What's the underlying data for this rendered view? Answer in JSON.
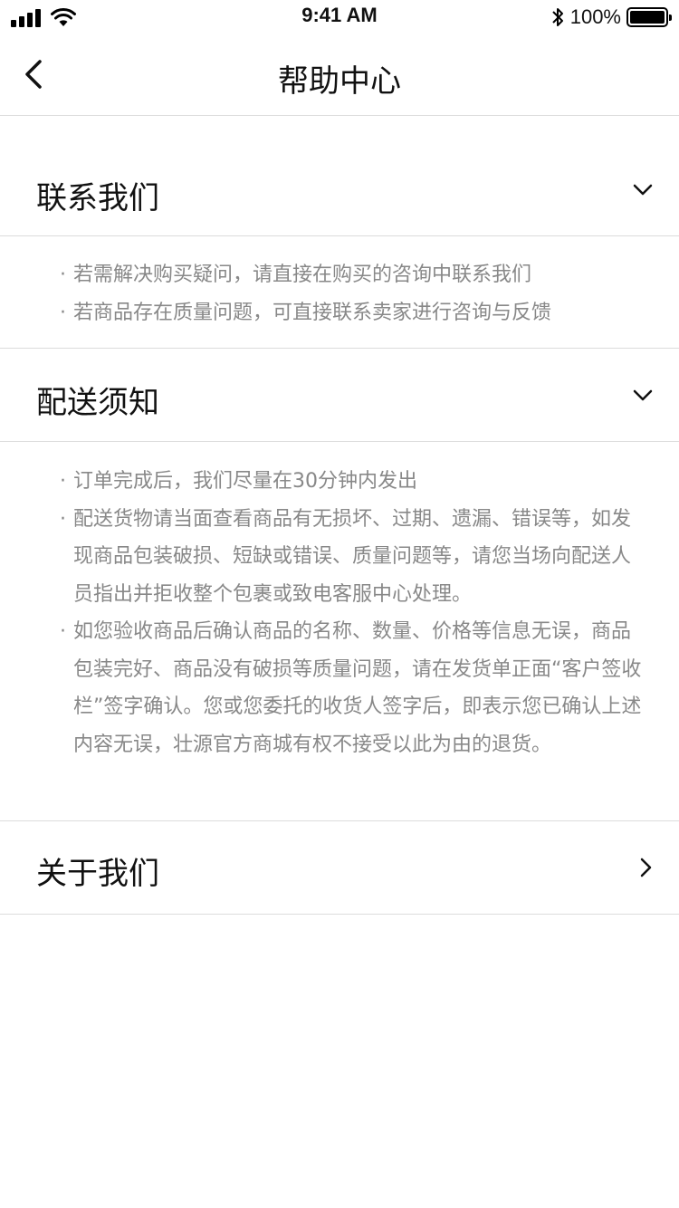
{
  "status_bar": {
    "time": "9:41 AM",
    "battery": "100%",
    "icons": [
      "signal-icon",
      "wifi-icon",
      "bluetooth-icon",
      "battery-icon"
    ]
  },
  "nav": {
    "back_icon": "chevron-left-icon",
    "title": "帮助中心"
  },
  "sections": [
    {
      "title": "联系我们",
      "icon": "chevron-down-icon",
      "items": [
        "若需解决购买疑问，请直接在购买的咨询中联系我们",
        "若商品存在质量问题，可直接联系卖家进行咨询与反馈"
      ]
    },
    {
      "title": "配送须知",
      "icon": "chevron-down-icon",
      "items": [
        "订单完成后，我们尽量在30分钟内发出",
        "配送货物请当面查看商品有无损坏、过期、遗漏、错误等，如发现商品包装破损、短缺或错误、质量问题等，请您当场向配送人员指出并拒收整个包裹或致电客服中心处理。",
        "如您验收商品后确认商品的名称、数量、价格等信息无误，商品包装完好、商品没有破损等质量问题，请在发货单正面“客户签收栏”签字确认。您或您委托的收货人签字后，即表示您已确认上述内容无误，壮源官方商城有权不接受以此为由的退货。"
      ]
    },
    {
      "title": "关于我们",
      "icon": "chevron-right-icon"
    }
  ]
}
